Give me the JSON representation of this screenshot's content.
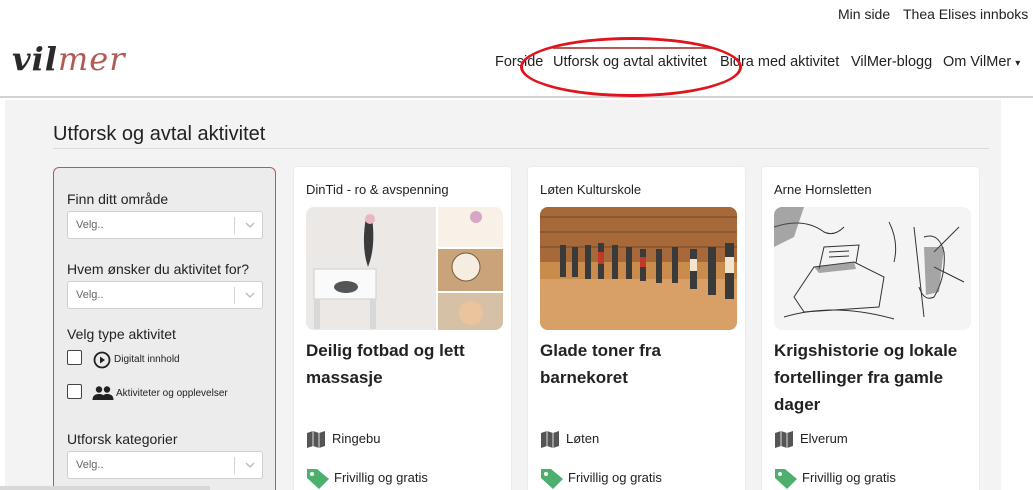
{
  "topbar": {
    "min_side": "Min side",
    "inbox": "Thea Elises innboks"
  },
  "logo": {
    "part1": "vil",
    "part2": "mer"
  },
  "nav": {
    "items": [
      "Forside",
      "Utforsk og avtal aktivitet",
      "Bidra med aktivitet",
      "VilMer-blogg",
      "Om VilMer"
    ],
    "caret": "▾"
  },
  "page": {
    "title": "Utforsk og avtal aktivitet"
  },
  "filters": {
    "area_label": "Finn ditt område",
    "area_placeholder": "Velg..",
    "for_label": "Hvem ønsker du aktivitet for?",
    "for_placeholder": "Velg..",
    "type_label": "Velg type aktivitet",
    "type_digital": "Digitalt innhold",
    "type_activities": "Aktiviteter og opplevelser",
    "category_label": "Utforsk kategorier",
    "category_placeholder": "Velg.."
  },
  "cards": [
    {
      "org": "DinTid - ro & avspenning",
      "title": "Deilig fotbad og lett massasje",
      "place": "Ringebu",
      "price": "Frivillig og gratis"
    },
    {
      "org": "Løten Kulturskole",
      "title": "Glade toner fra barnekoret",
      "place": "Løten",
      "price": "Frivillig og gratis"
    },
    {
      "org": "Arne Hornsletten",
      "title": "Krigshistorie og lokale fortellinger fra gamle dager",
      "place": "Elverum",
      "price": "Frivillig og gratis"
    }
  ],
  "colors": {
    "brand": "#b25b54",
    "annotation_circle": "#e0141c",
    "tag_green": "#4caf6e"
  },
  "icons": {
    "map": "map-icon",
    "tag": "price-tag-icon",
    "play": "play-circle-icon",
    "people": "people-icon",
    "chevron": "chevron-down-icon"
  }
}
